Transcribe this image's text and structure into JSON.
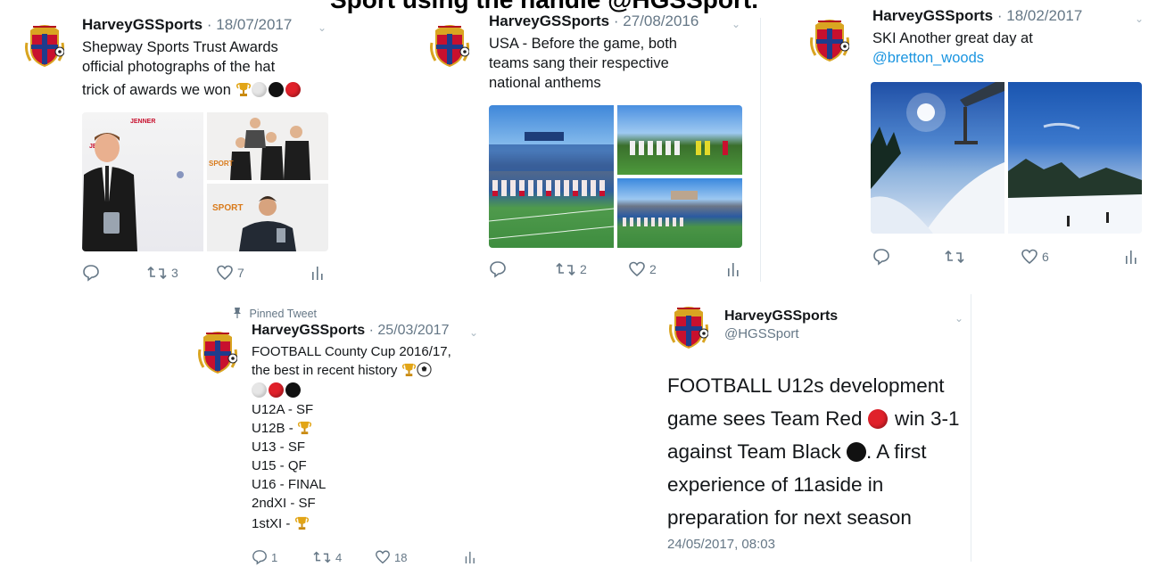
{
  "headline": "Sport using the handle @HGSSport.",
  "colors": {
    "link": "#1b95e0",
    "muted": "#657786",
    "text": "#14171a"
  },
  "tweets": [
    {
      "handle": "HarveyGSSports",
      "date": "· 18/07/2017",
      "lines": [
        "Shepway Sports Trust Awards",
        "official photographs of the hat",
        "trick of awards we won"
      ],
      "emoji_tail": [
        "trophy-icon",
        "white-circle-icon",
        "black-circle-icon",
        "red-circle-icon"
      ],
      "actions": {
        "reply": "",
        "retweet": "3",
        "like": "7"
      },
      "media": [
        "awards-photo-boy-with-trophy",
        "awards-photo-group",
        "awards-photo-man-with-trophy"
      ],
      "photo_text": {
        "sponsor": "JENNER",
        "backdrop": "SPORT"
      }
    },
    {
      "handle": "HarveyGSSports",
      "date": "· 27/08/2016",
      "lines": [
        "USA - Before the game, both",
        "teams sang their respective",
        "national anthems"
      ],
      "actions": {
        "reply": "",
        "retweet": "2",
        "like": "2"
      },
      "media": [
        "stadium-team-line",
        "team-on-field",
        "stadium-wide"
      ]
    },
    {
      "handle": "HarveyGSSports",
      "date": "· 18/02/2017",
      "lines": [
        "SKI Another great day at"
      ],
      "link": "@bretton_woods",
      "actions": {
        "reply": "",
        "retweet": "",
        "like": "6"
      },
      "media": [
        "ski-lift-sun",
        "ski-slope-snow"
      ]
    },
    {
      "pinned": "Pinned Tweet",
      "handle": "HarveyGSSports",
      "date": "· 25/03/2017",
      "lines": [
        "FOOTBALL County Cup 2016/17,",
        "the best in recent history"
      ],
      "results": [
        "U12A - SF",
        "U12B -",
        "U13 - SF",
        "U15 - QF",
        "U16 - FINAL",
        "2ndXI - SF",
        "1stXI -"
      ],
      "actions": {
        "reply": "1",
        "retweet": "4",
        "like": "18"
      }
    },
    {
      "handle": "HarveyGSSports",
      "username": "@HGSSport",
      "lines": [
        "FOOTBALL U12s development",
        "game sees Team Red",
        "win 3-1",
        "against Team Black",
        ". A first",
        "experience of 11aside in",
        "preparation for next season"
      ],
      "timestamp": "24/05/2017, 08:03"
    }
  ]
}
